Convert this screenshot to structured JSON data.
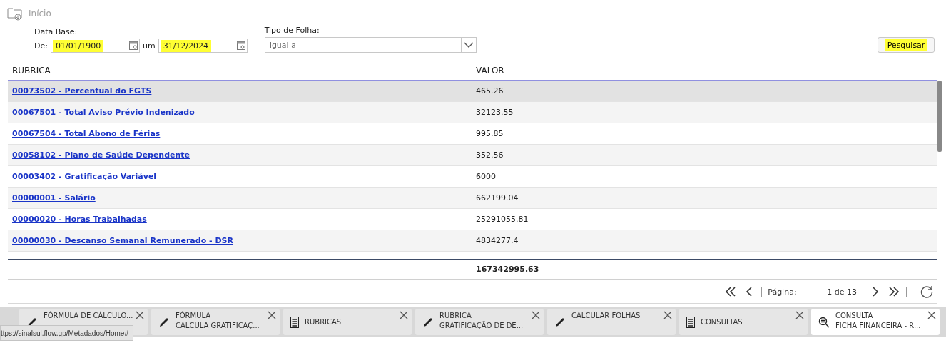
{
  "breadcrumb": {
    "label": "Início"
  },
  "filters": {
    "date_label": "Data Base:",
    "from_label": "De:",
    "from_value": "01/01/1900",
    "from_highlighted": true,
    "to_label": "um",
    "to_value": "31/12/2024",
    "to_highlighted": true,
    "type_label": "Tipo de Folha:",
    "type_value": "Igual a",
    "search_button": "Pesquisar",
    "search_highlighted": true
  },
  "table": {
    "columns": [
      "RUBRICA",
      "VALOR"
    ],
    "rows": [
      {
        "rubrica": "00073502 - Percentual do FGTS",
        "valor": "465.26",
        "selected": true
      },
      {
        "rubrica": "00067501 - Total Aviso Prévio Indenizado",
        "valor": "32123.55",
        "selected": false
      },
      {
        "rubrica": "00067504 - Total Abono de Férias",
        "valor": "995.85",
        "selected": false
      },
      {
        "rubrica": "00058102 - Plano de Saúde Dependente",
        "valor": "352.56",
        "selected": false
      },
      {
        "rubrica": "00003402 - Gratificação Variável",
        "valor": "6000",
        "selected": false
      },
      {
        "rubrica": "00000001 - Salário",
        "valor": "662199.04",
        "selected": false
      },
      {
        "rubrica": "00000020 - Horas Trabalhadas",
        "valor": "25291055.81",
        "selected": false
      },
      {
        "rubrica": "00000030 - Descanso Semanal Remunerado - DSR",
        "valor": "4834277.4",
        "selected": false
      }
    ],
    "total": "167342995.63"
  },
  "pagination": {
    "label": "Página:",
    "page": "1 de 13"
  },
  "tabs": [
    {
      "kind": "edit",
      "lines": [
        "FÓRMULA DE CÁLCULO..."
      ],
      "selected": false
    },
    {
      "kind": "edit",
      "lines": [
        "FÓRMULA",
        "CALCULA GRATIFICAÇ..."
      ],
      "selected": false
    },
    {
      "kind": "list",
      "lines": [
        "RUBRICAS"
      ],
      "selected": false
    },
    {
      "kind": "edit",
      "lines": [
        "RUBRICA",
        "GRATIFICAÇÃO DE DE..."
      ],
      "selected": false
    },
    {
      "kind": "edit",
      "lines": [
        "CALCULAR FOLHAS"
      ],
      "selected": false
    },
    {
      "kind": "list",
      "lines": [
        "CONSULTAS"
      ],
      "selected": false
    },
    {
      "kind": "search",
      "lines": [
        "CONSULTA",
        "FICHA FINANCEIRA - R..."
      ],
      "selected": true
    }
  ],
  "status_url": "ttps://sinalsul.flow.gp/Metadados/Home#"
}
